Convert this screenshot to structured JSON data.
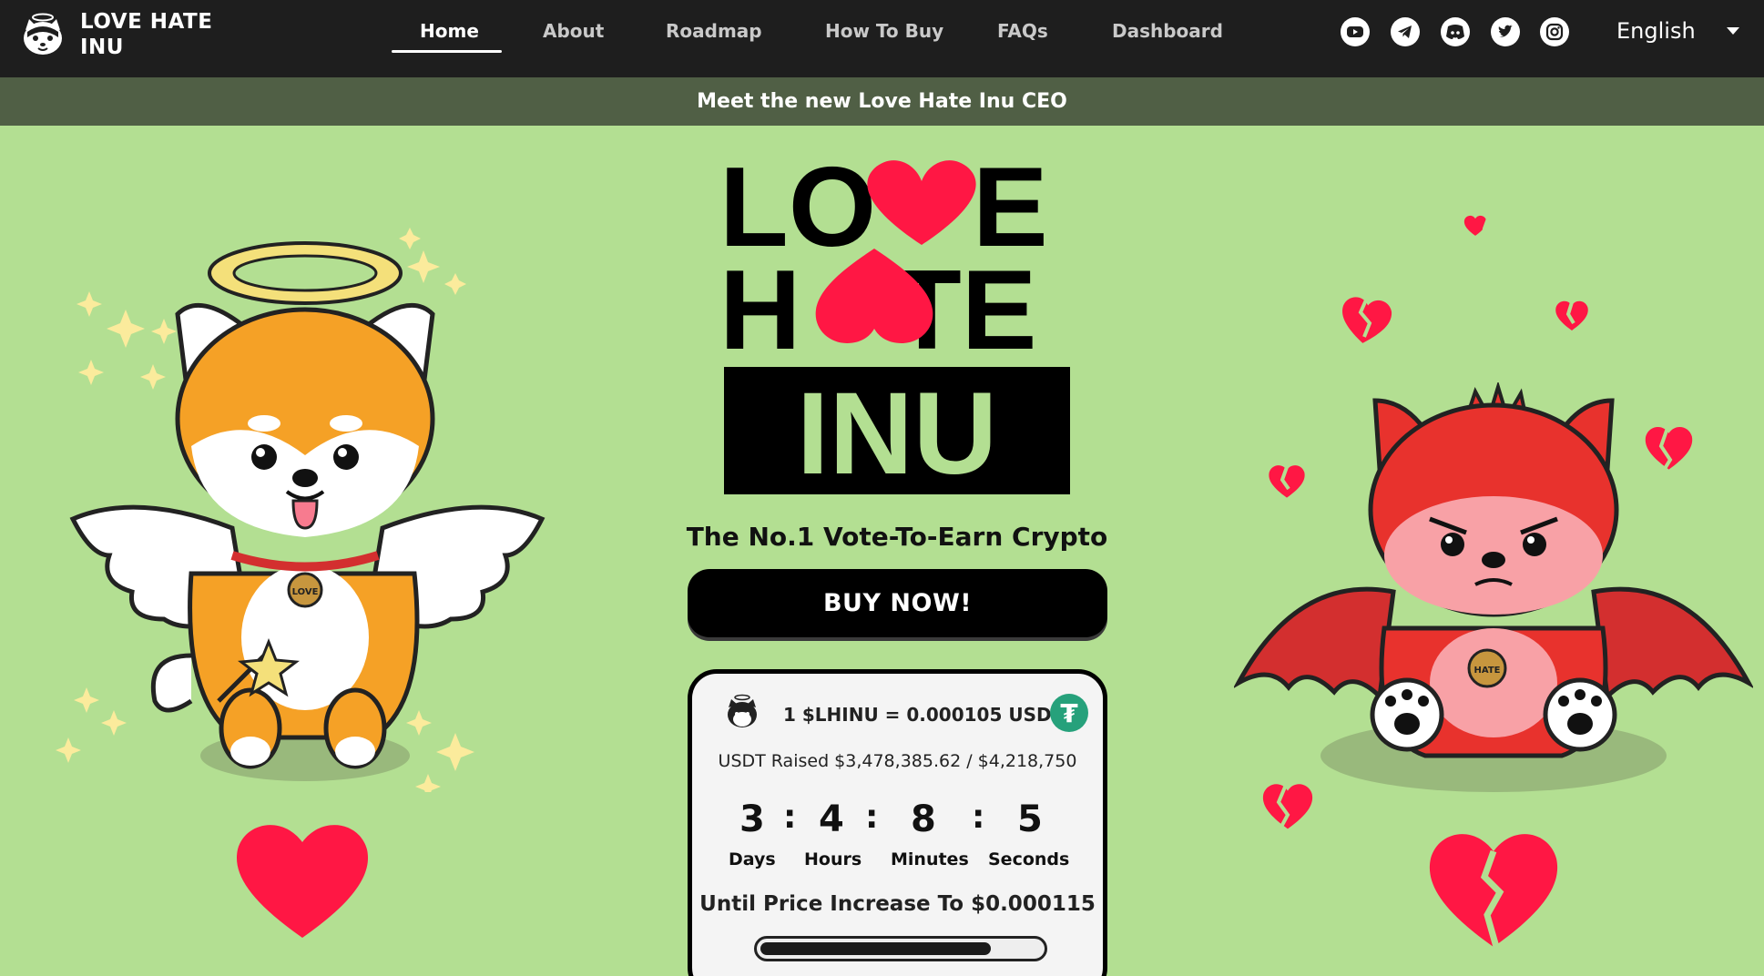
{
  "brand": {
    "name": "LOVE HATE INU"
  },
  "nav": {
    "items": [
      {
        "label": "Home",
        "active": true
      },
      {
        "label": "About"
      },
      {
        "label": "Roadmap"
      },
      {
        "label": "How To Buy"
      },
      {
        "label": "FAQs"
      },
      {
        "label": "Dashboard"
      }
    ],
    "social": [
      "youtube-icon",
      "telegram-icon",
      "discord-icon",
      "twitter-icon",
      "instagram-icon"
    ],
    "language": "English"
  },
  "announcement": "Meet the new Love Hate Inu CEO",
  "hero": {
    "logo_lines": [
      "LOVE",
      "HATE",
      "INU"
    ],
    "tagline": "The No.1 Vote-To-Earn Crypto",
    "buy_label": "BUY NOW!",
    "love_badge": "LOVE",
    "hate_badge": "HATE"
  },
  "presale": {
    "rate": "1 $LHINU = 0.000105 USDT",
    "raised": "USDT Raised $3,478,385.62 / $4,218,750",
    "countdown": [
      {
        "value": "3",
        "label": "Days"
      },
      {
        "value": "4",
        "label": "Hours"
      },
      {
        "value": "8",
        "label": "Minutes"
      },
      {
        "value": "5",
        "label": "Seconds"
      }
    ],
    "until_text": "Until Price Increase To $0.000115",
    "progress_fraction": 0.82
  },
  "colors": {
    "background": "#b3df92",
    "navbar": "#1e1e1e",
    "announcement": "#505f45",
    "heart": "#ff1744",
    "tether": "#26a17b"
  }
}
